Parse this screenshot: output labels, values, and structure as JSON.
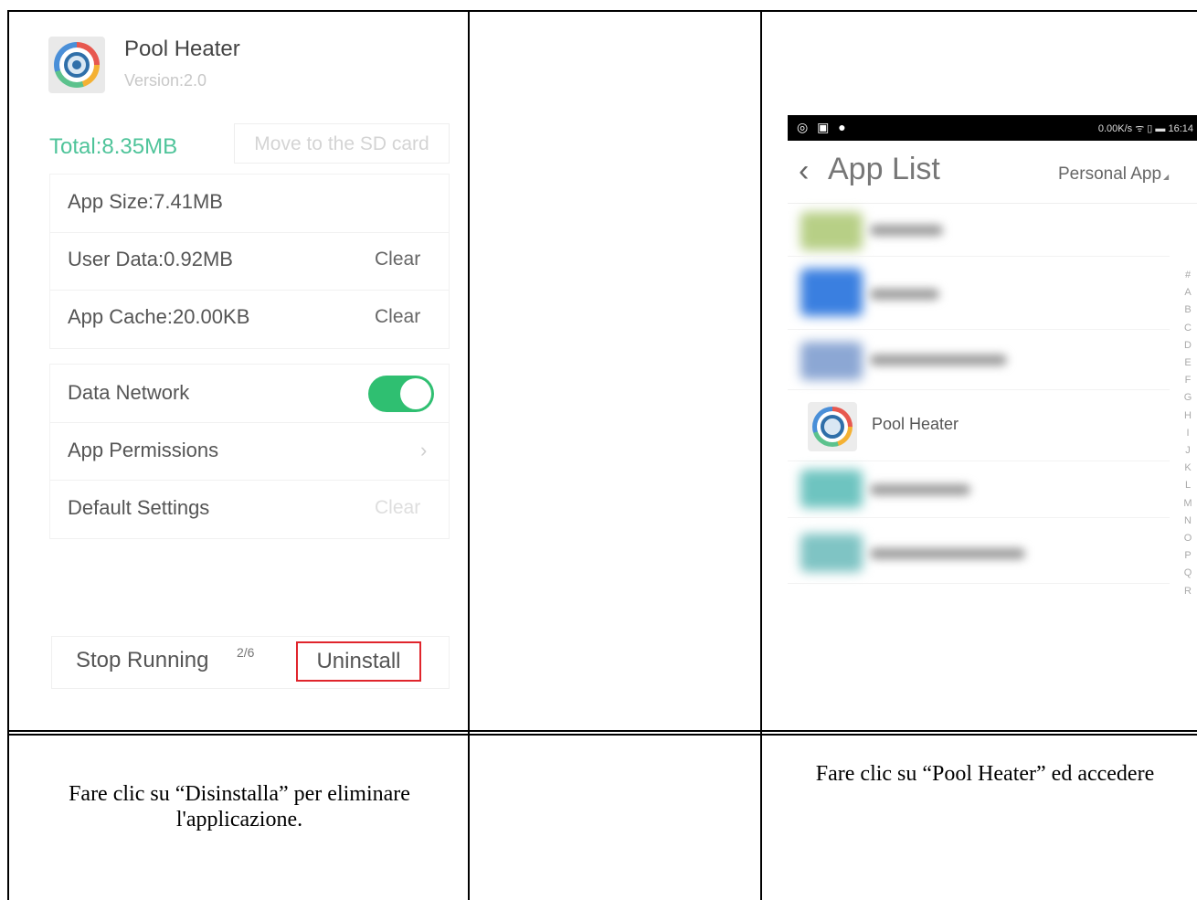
{
  "left_panel": {
    "app_name": "Pool Heater",
    "version": "Version:2.0",
    "total": "Total:8.35MB",
    "move_button": "Move to the SD card",
    "app_size": "App Size:7.41MB",
    "user_data": "User Data:0.92MB",
    "user_data_action": "Clear",
    "app_cache": "App Cache:20.00KB",
    "app_cache_action": "Clear",
    "data_network": "Data Network",
    "data_network_enabled": true,
    "app_permissions": "App Permissions",
    "permissions_chevron": "›",
    "default_settings": "Default Settings",
    "default_settings_action": "Clear",
    "stop_running": "Stop Running",
    "running_count": "2/6",
    "uninstall": "Uninstall",
    "accent_color": "#4fc49a",
    "toggle_color": "#2fbf71",
    "highlight_color": "#e0252c"
  },
  "right_panel": {
    "status_left": "◎ ▣ ●",
    "status_right": "0.00K/s ᯤ ▯ ▬ 16:14",
    "back_icon": "‹",
    "title": "App List",
    "filter": "Personal App",
    "filter_icon": "◢",
    "app_item": "Pool Heater",
    "alphabet": [
      "#",
      "A",
      "B",
      "C",
      "D",
      "E",
      "F",
      "G",
      "H",
      "I",
      "J",
      "K",
      "L",
      "M",
      "N",
      "O",
      "P",
      "Q",
      "R"
    ]
  },
  "captions": {
    "left": "Fare clic su “Disinstalla” per eliminare l'applicazione.",
    "right": "Fare clic su “Pool Heater” ed accedere"
  }
}
